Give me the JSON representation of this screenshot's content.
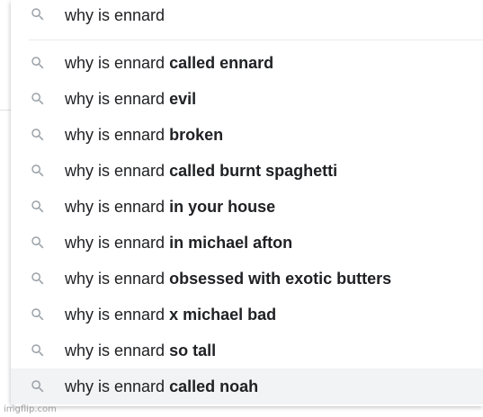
{
  "search": {
    "query": "why is ennard"
  },
  "suggestions": [
    {
      "prefix": "why is ennard",
      "completion": "called ennard"
    },
    {
      "prefix": "why is ennard",
      "completion": "evil"
    },
    {
      "prefix": "why is ennard",
      "completion": "broken"
    },
    {
      "prefix": "why is ennard",
      "completion": "called burnt spaghetti"
    },
    {
      "prefix": "why is ennard",
      "completion": "in your house"
    },
    {
      "prefix": "why is ennard",
      "completion": "in michael afton"
    },
    {
      "prefix": "why is ennard",
      "completion": "obsessed with exotic butters"
    },
    {
      "prefix": "why is ennard",
      "completion": "x michael bad"
    },
    {
      "prefix": "why is ennard",
      "completion": "so tall"
    },
    {
      "prefix": "why is ennard",
      "completion": "called noah"
    }
  ],
  "highlighted_index": 9,
  "watermark": "imgflip.com",
  "colors": {
    "text": "#202124",
    "icon": "#9aa0a6",
    "highlight_bg": "#f1f3f4",
    "divider": "#e8eaed"
  },
  "icons": {
    "search": "search-icon"
  }
}
